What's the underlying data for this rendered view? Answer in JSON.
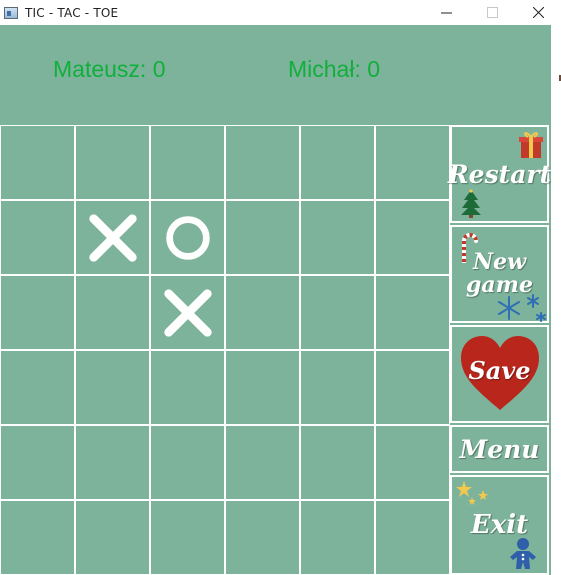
{
  "window": {
    "title": "TIC - TAC - TOE",
    "minimize_icon": "minimize-icon",
    "maximize_icon": "maximize-icon",
    "close_icon": "close-icon"
  },
  "scores": {
    "player1": "Mateusz: 0",
    "player2": "Michał: 0",
    "color": "#10b03c"
  },
  "board": {
    "rows": 6,
    "cols": 6,
    "background": "#7db39a",
    "cells": [
      [
        "",
        "",
        "",
        "",
        "",
        ""
      ],
      [
        "",
        "X",
        "O",
        "",
        "",
        ""
      ],
      [
        "",
        "",
        "X",
        "",
        "",
        ""
      ],
      [
        "",
        "",
        "",
        "",
        "",
        ""
      ],
      [
        "",
        "",
        "",
        "",
        "",
        ""
      ],
      [
        "",
        "",
        "",
        "",
        "",
        ""
      ]
    ]
  },
  "menu": {
    "restart_label": "Restart",
    "new_game_label": "New game",
    "save_label": "Save",
    "menu_label": "Menu",
    "exit_label": "Exit",
    "heart_color": "#b8261c"
  }
}
